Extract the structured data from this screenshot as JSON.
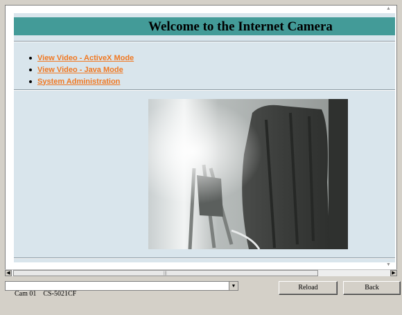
{
  "page": {
    "title": "Welcome to the Internet Camera",
    "links": [
      {
        "label": "View Video - ActiveX Mode"
      },
      {
        "label": "View Video - Java Mode"
      },
      {
        "label": "System Administration"
      }
    ],
    "colors": {
      "title_bar": "#439b98",
      "link": "#f07822",
      "page_bg": "#d9e5ec",
      "window_bg": "#d4d0c8"
    }
  },
  "camera": {
    "feed_icon": "camera-feed-image"
  },
  "bottom": {
    "camera_select_value": "Cam 01    CS-5021CF",
    "reload_label": "Reload",
    "back_label": "Back"
  }
}
